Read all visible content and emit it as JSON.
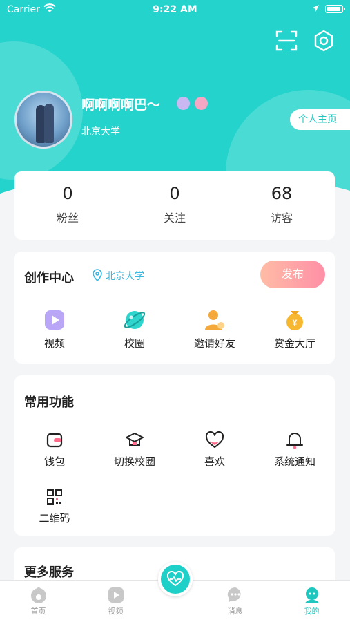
{
  "status_bar": {
    "carrier": "Carrier",
    "time": "9:22 AM"
  },
  "header": {
    "scan_icon": "scan-icon",
    "settings_icon": "settings-icon"
  },
  "profile": {
    "username": "啊啊啊啊巴～",
    "school": "北京大学",
    "homepage_button": "个人主页"
  },
  "stats": [
    {
      "value": "0",
      "label": "粉丝"
    },
    {
      "value": "0",
      "label": "关注"
    },
    {
      "value": "68",
      "label": "访客"
    }
  ],
  "creation_center": {
    "title": "创作中心",
    "school": "北京大学",
    "publish_button": "发布",
    "items": [
      {
        "label": "视频",
        "icon": "video-icon"
      },
      {
        "label": "校圈",
        "icon": "planet-icon"
      },
      {
        "label": "邀请好友",
        "icon": "invite-user-icon"
      },
      {
        "label": "赏金大厅",
        "icon": "bounty-money-bag-icon"
      }
    ]
  },
  "common_functions": {
    "title": "常用功能",
    "items": [
      {
        "label": "钱包",
        "icon": "wallet-icon"
      },
      {
        "label": "切换校圈",
        "icon": "graduation-cap-icon"
      },
      {
        "label": "喜欢",
        "icon": "heart-icon"
      },
      {
        "label": "系统通知",
        "icon": "bell-icon"
      },
      {
        "label": "二维码",
        "icon": "qr-code-icon"
      }
    ]
  },
  "more_services": {
    "title": "更多服务"
  },
  "tabbar": [
    {
      "label": "首页",
      "icon": "home-icon"
    },
    {
      "label": "视频",
      "icon": "video-tab-icon"
    },
    {
      "label": "",
      "icon": "heart-pulse-icon"
    },
    {
      "label": "消息",
      "icon": "message-icon"
    },
    {
      "label": "我的",
      "icon": "profile-icon",
      "active": true
    }
  ],
  "colors": {
    "accent": "#24d3cc",
    "publish_gradient_start": "#ffbca6",
    "publish_gradient_end": "#ff8fa6",
    "link": "#39b8e0"
  }
}
